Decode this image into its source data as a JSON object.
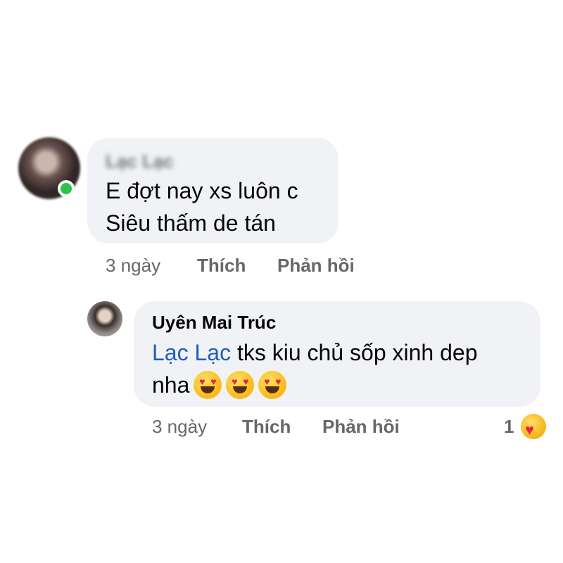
{
  "comment": {
    "author": "Lạc Lạc",
    "lines": [
      "E đợt nay xs luôn c",
      "Siêu thấm de tán"
    ],
    "time": "3 ngày",
    "like_label": "Thích",
    "reply_label": "Phản hồi"
  },
  "reply": {
    "author": "Uyên Mai Trúc",
    "mention": "Lạc Lạc",
    "line1_rest": " tks kiu chủ sốp xinh dep",
    "line2": "nha",
    "emojis": [
      "heart-eyes-emoji",
      "heart-eyes-emoji",
      "heart-eyes-emoji"
    ],
    "time": "3 ngày",
    "like_label": "Thích",
    "reply_label": "Phản hồi",
    "reaction_count": "1",
    "reaction_icon": "care-reaction-icon"
  },
  "colors": {
    "bubble": "#f0f2f5",
    "mention": "#1f5fb8",
    "meta_text": "#65676b",
    "online": "#31c24d"
  }
}
